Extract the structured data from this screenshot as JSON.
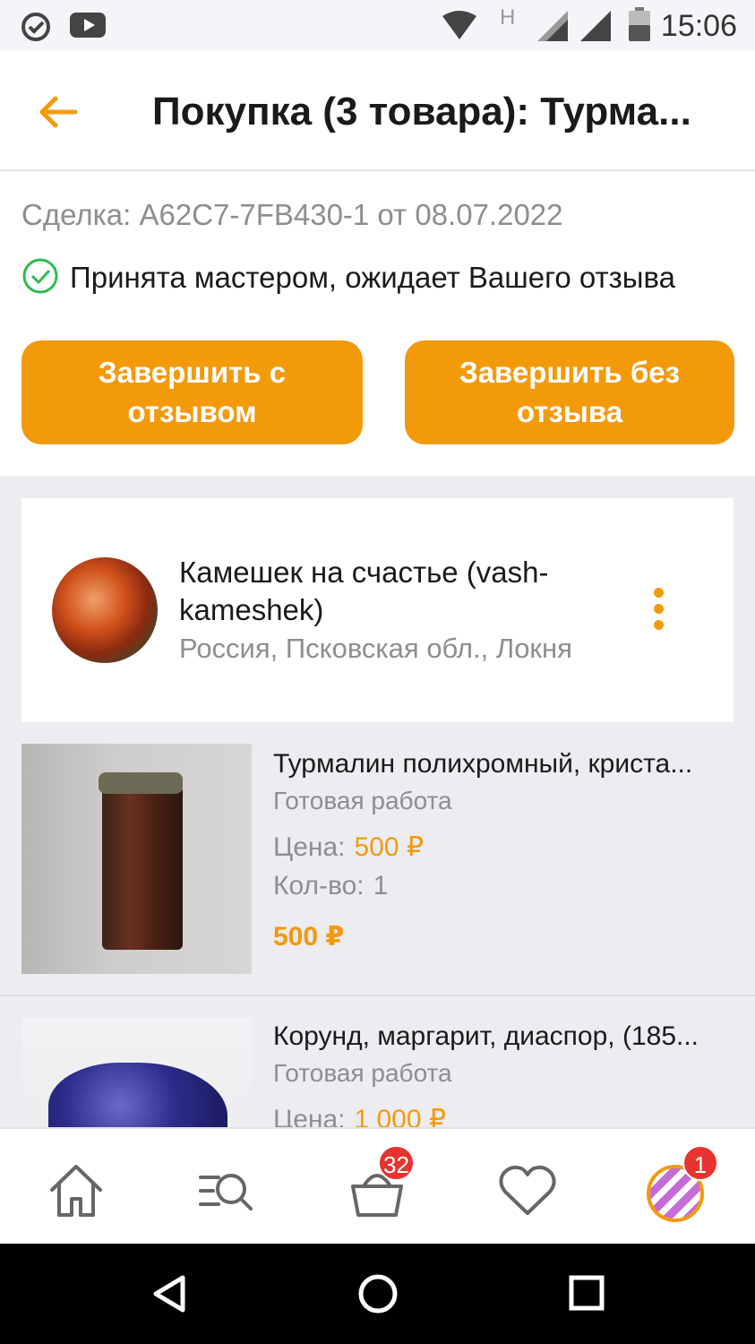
{
  "status_bar": {
    "time": "15:06",
    "network_label": "H"
  },
  "header": {
    "title": "Покупка (3 товара): Турма..."
  },
  "deal": {
    "id_text": "Сделка: A62C7-7FB430-1 от 08.07.2022",
    "status_text": "Принята мастером, ожидает Вашего отзыва",
    "buttons": {
      "complete_with_review": "Завершить с отзывом",
      "complete_without_review": "Завершить без отзыва"
    }
  },
  "seller": {
    "name": "Камешек на счастье (vash-kameshek)",
    "location": "Россия, Псковская обл., Локня"
  },
  "products": [
    {
      "title": "Турмалин полихромный, криста...",
      "type": "Готовая работа",
      "price_label": "Цена:",
      "price": "500 ₽",
      "qty_label": "Кол-во:",
      "qty": "1",
      "total": "500 ₽"
    },
    {
      "title": "Корунд, маргарит, диаспор, (185...",
      "type": "Готовая работа",
      "price_label": "Цена:",
      "price": "1 000 ₽"
    }
  ],
  "bottom_nav": {
    "cart_badge": "32",
    "profile_badge": "1"
  },
  "colors": {
    "accent": "#f39a0a",
    "badge": "#e8332e",
    "success": "#2dbb4f"
  }
}
